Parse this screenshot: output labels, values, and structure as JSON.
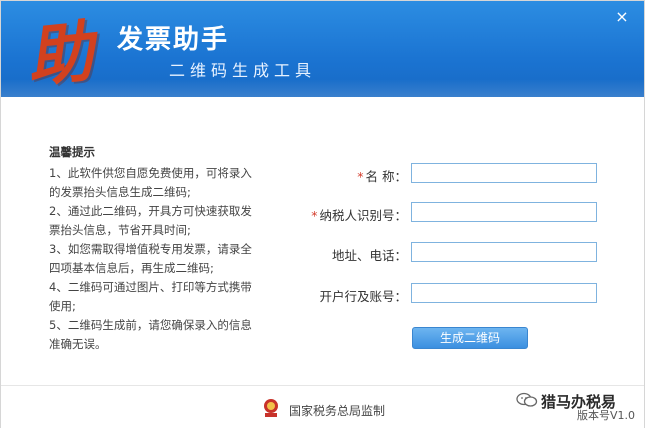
{
  "window": {
    "logo_glyph": "助",
    "title": "发票助手",
    "subtitle": "二维码生成工具",
    "close_glyph": "×"
  },
  "tips": {
    "title": "温馨提示",
    "lines": [
      "1、此软件供您自愿免费使用，可将录入",
      "的发票抬头信息生成二维码;",
      "2、通过此二维码，开具方可快速获取发",
      "票抬头信息，节省开具时间;",
      "3、如您需取得增值税专用发票，请录全",
      "四项基本信息后，再生成二维码;",
      "4、二维码可通过图片、打印等方式携带",
      "使用;",
      "5、二维码生成前，请您确保录入的信息",
      "准确无误。"
    ]
  },
  "form": {
    "required_mark": "*",
    "fields": [
      {
        "label": "名      称：",
        "required": true,
        "value": ""
      },
      {
        "label": "纳税人识别号：",
        "required": true,
        "value": ""
      },
      {
        "label": "地址、电话：",
        "required": false,
        "value": ""
      },
      {
        "label": "开户行及账号：",
        "required": false,
        "value": ""
      }
    ],
    "generate_button": "生成二维码"
  },
  "footer": {
    "authority": "国家税务总局监制",
    "watermark": "猎马办税易",
    "version": "版本号V1.0"
  },
  "colors": {
    "header_blue": "#1b74d2",
    "logo_red": "#d2411e",
    "input_border": "#7fb3df",
    "button_blue": "#3b8fe0",
    "required_red": "#d43c2c"
  }
}
